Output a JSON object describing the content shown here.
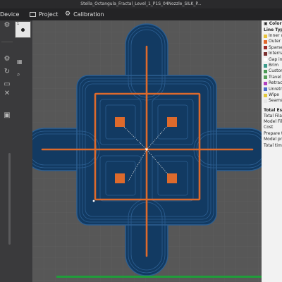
{
  "window": {
    "title": "Stella_Octangula_Fractal_Level_1_P1S_04Nozzle_SILK_P..."
  },
  "menu": {
    "device": "Device",
    "project": "Project",
    "calibration": "Calibration"
  },
  "plate": {
    "number": "1"
  },
  "legend": {
    "color_scheme": "Color",
    "line_type_header": "Line Type",
    "items": [
      {
        "label": "Inner w",
        "color": "#e8c23a"
      },
      {
        "label": "Outer w",
        "color": "#e0652a"
      },
      {
        "label": "Sparse",
        "color": "#9b2a2a"
      },
      {
        "label": "Interna",
        "color": "#7a3030"
      },
      {
        "label": "Gap infi",
        "color": "#ffffff"
      },
      {
        "label": "Brim",
        "color": "#3c9c8c"
      },
      {
        "label": "Custom",
        "color": "#4c9a55"
      },
      {
        "label": "Travel",
        "color": "#58a05a"
      },
      {
        "label": "Retract",
        "color": "#b23fbf"
      },
      {
        "label": "Unretra",
        "color": "#4a6cc8"
      },
      {
        "label": "Wipe",
        "color": "#e2c93a"
      },
      {
        "label": "Seams",
        "color": "#e8e8e8"
      }
    ],
    "estimation_header": "Total Esti",
    "stats": [
      "Total Filam",
      "Model Fila",
      "Cost",
      "Prepare ti",
      "Model pri",
      "Total tim"
    ]
  },
  "colors": {
    "toolpath_fill": "#123a62",
    "toolpath_line": "#2c5f92",
    "infill_orange": "#dd6a2c",
    "accent_green": "#1f9d3a"
  }
}
